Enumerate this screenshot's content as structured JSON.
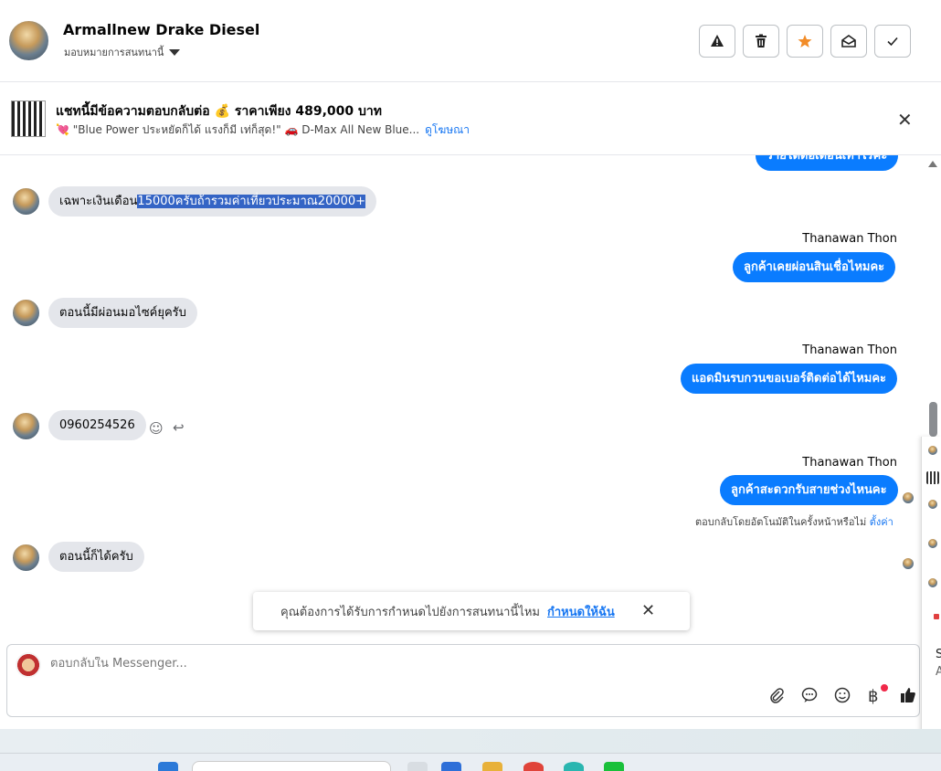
{
  "header": {
    "name": "Armallnew Drake Diesel",
    "assign_label": "มอบหมายการสนทนานี้",
    "buttons": [
      "report",
      "delete",
      "star",
      "mark-unread",
      "done"
    ]
  },
  "banner": {
    "title": "แชทนี้มีข้อความตอบกลับต่อ 💰 ราคาเพียง 489,000 บาท",
    "desc": "💘 \"Blue Power ประหยัดก็ได้ แรงก็มี เท่ก็สุด!\" 🚗 D-Max All New Blue...",
    "link": "ดูโฆษณา"
  },
  "messages": {
    "top_cut": "รายได้ต่อเดือนเท่าไรคะ",
    "m1_pre": "เฉพาะเงินเดือน",
    "m1_hl": "15000ครับถ้ารวมค่าเที่ยวประมาณ20000+",
    "s1": "Thanawan Thon",
    "o1": "ลูกค้าเคยผ่อนสินเชื่อไหมคะ",
    "m2": "ตอนนี้มีผ่อนมอไซค์ยุครับ",
    "s2": "Thanawan Thon",
    "o2": "แอดมินรบกวนขอเบอร์ติดต่อได้ไหมคะ",
    "m3": "0960254526",
    "s3": "Thanawan Thon",
    "o3": "ลูกค้าสะดวกรับสายช่วงไหนคะ",
    "auto_text": "ตอบกลับโดยอัตโนมัติในครั้งหน้าหรือไม่",
    "auto_link": "ตั้งค่า",
    "m4": "ตอนนี้ก็ได้ครับ"
  },
  "notice": {
    "text": "คุณต้องการได้รับการกำหนดไปยังการสนทนานี้ไหม",
    "link": "กำหนดให้ฉัน"
  },
  "composer": {
    "placeholder": "ตอบกลับใน Messenger..."
  },
  "side": {
    "letters": [
      "S",
      "A"
    ]
  },
  "colors": {
    "outgoing": "#0a7cff",
    "incoming": "#e4e6eb",
    "link": "#1877f2",
    "highlight": "#3464c5"
  }
}
